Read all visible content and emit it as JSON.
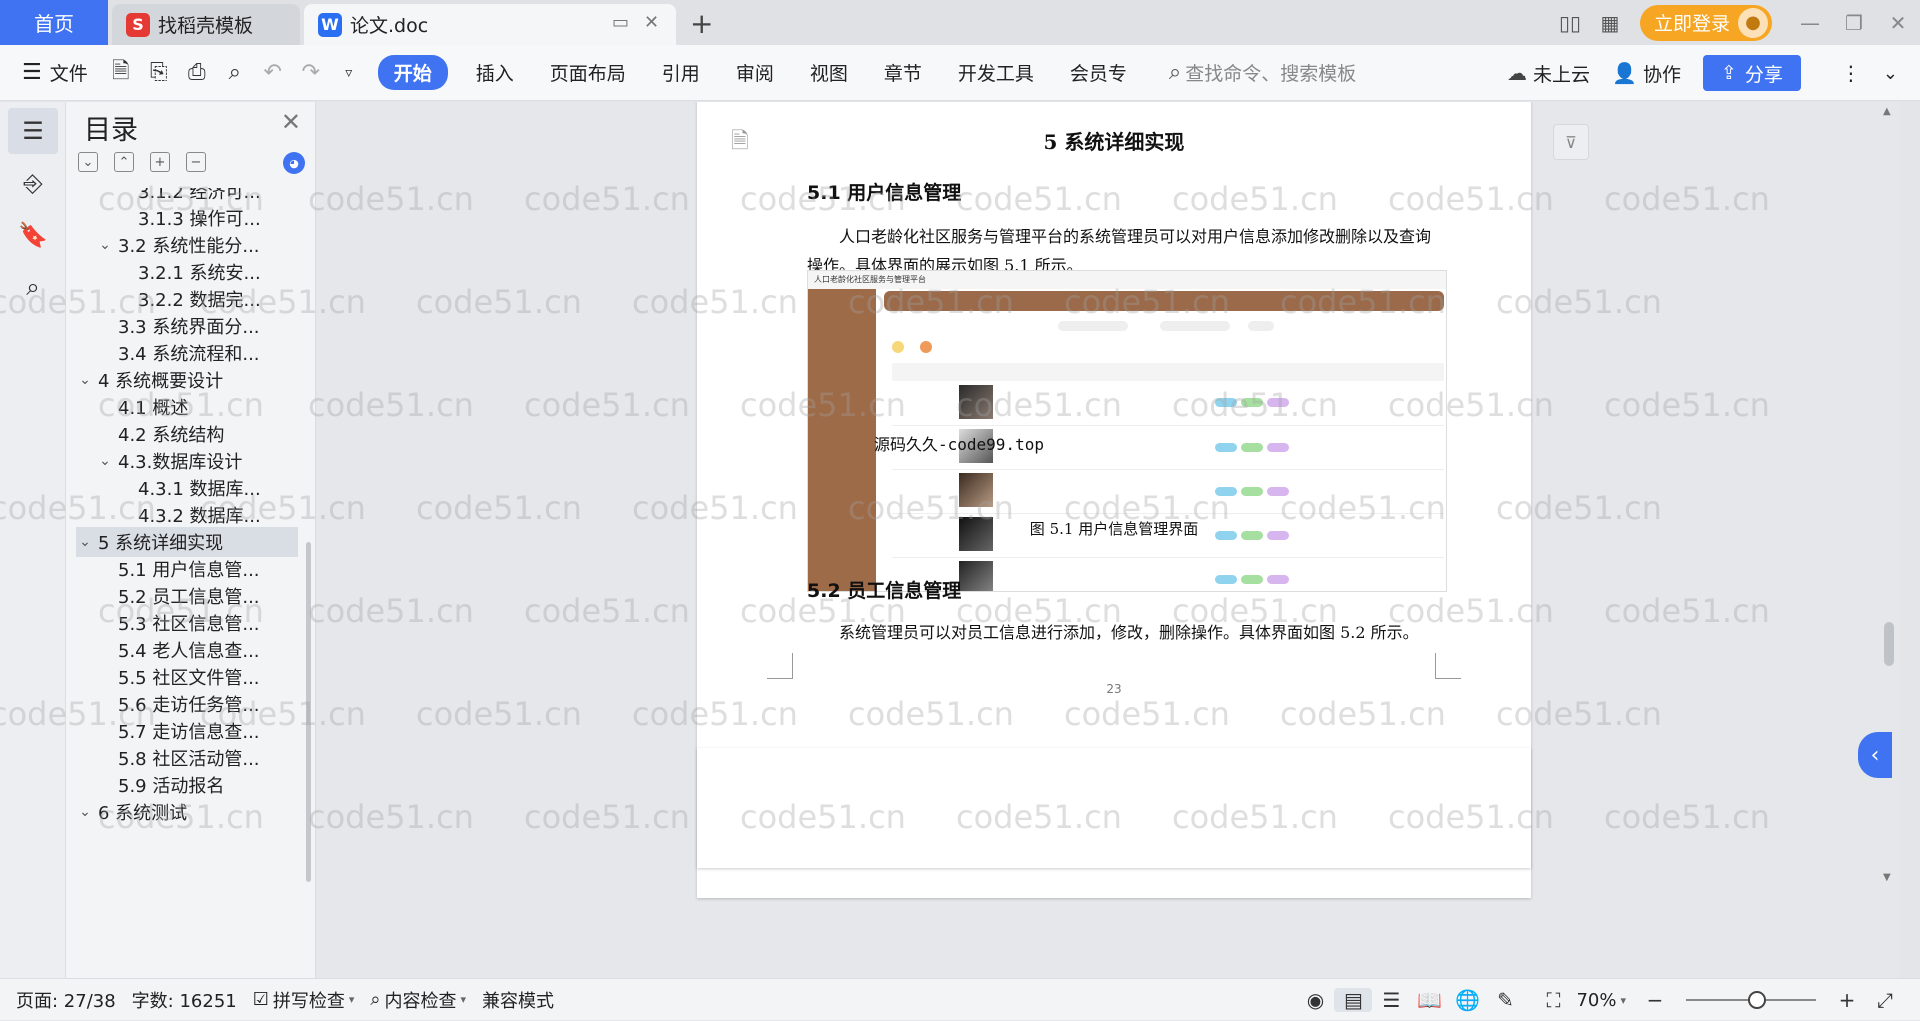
{
  "tabs": {
    "home": "首页",
    "template": "找稻壳模板",
    "doc": "论文.doc",
    "login": "立即登录"
  },
  "toolbar": {
    "file": "文件",
    "tabs": [
      "开始",
      "插入",
      "页面布局",
      "引用",
      "审阅",
      "视图",
      "章节",
      "开发工具",
      "会员专"
    ],
    "search_placeholder": "查找命令、搜索模板",
    "cloud": "未上云",
    "collab": "协作",
    "share": "分享"
  },
  "toc": {
    "title": "目录",
    "items": [
      {
        "label": "3.1.2 经济可...",
        "level": 3,
        "arrow": ""
      },
      {
        "label": "3.1.3 操作可...",
        "level": 3,
        "arrow": ""
      },
      {
        "label": "3.2 系统性能分...",
        "level": 2,
        "arrow": "⌄"
      },
      {
        "label": "3.2.1  系统安...",
        "level": 3,
        "arrow": ""
      },
      {
        "label": "3.2.2  数据完...",
        "level": 3,
        "arrow": ""
      },
      {
        "label": "3.3 系统界面分...",
        "level": 2,
        "arrow": ""
      },
      {
        "label": "3.4 系统流程和...",
        "level": 2,
        "arrow": ""
      },
      {
        "label": "4 系统概要设计",
        "level": 1,
        "arrow": "⌄"
      },
      {
        "label": "4.1 概述",
        "level": 2,
        "arrow": ""
      },
      {
        "label": "4.2 系统结构",
        "level": 2,
        "arrow": ""
      },
      {
        "label": "4.3.数据库设计",
        "level": 2,
        "arrow": "⌄"
      },
      {
        "label": "4.3.1 数据库...",
        "level": 3,
        "arrow": ""
      },
      {
        "label": "4.3.2 数据库...",
        "level": 3,
        "arrow": ""
      },
      {
        "label": "5 系统详细实现",
        "level": 1,
        "arrow": "⌄"
      },
      {
        "label": "5.1  用户信息管...",
        "level": 2,
        "arrow": ""
      },
      {
        "label": "5.2  员工信息管...",
        "level": 2,
        "arrow": ""
      },
      {
        "label": "5.3  社区信息管...",
        "level": 2,
        "arrow": ""
      },
      {
        "label": "5.4  老人信息查...",
        "level": 2,
        "arrow": ""
      },
      {
        "label": "5.5  社区文件管...",
        "level": 2,
        "arrow": ""
      },
      {
        "label": "5.6  走访任务管...",
        "level": 2,
        "arrow": ""
      },
      {
        "label": "5.7  走访信息查...",
        "level": 2,
        "arrow": ""
      },
      {
        "label": "5.8  社区活动管...",
        "level": 2,
        "arrow": ""
      },
      {
        "label": "5.9  活动报名",
        "level": 2,
        "arrow": ""
      },
      {
        "label": "6 系统测试",
        "level": 1,
        "arrow": "⌄"
      }
    ]
  },
  "doc": {
    "chapter": "5 系统详细实现",
    "sec1": "5.1  用户信息管理",
    "para1": "人口老龄化社区服务与管理平台的系统管理员可以对用户信息添加修改删除以及查询操作。具体界面的展示如图 5.1 所示。",
    "fig_caption": "图 5.1  用户信息管理界面",
    "sec2": "5.2  员工信息管理",
    "para2": "系统管理员可以对员工信息进行添加，修改，删除操作。具体界面如图 5.2 所示。",
    "page_number": "23",
    "overlay": "源码久久-code99.top",
    "shot_title": "人口老龄化社区服务与管理平台"
  },
  "watermark": "code51.cn",
  "status": {
    "page": "页面: 27/38",
    "words": "字数: 16251",
    "spell": "拼写检查",
    "content": "内容检查",
    "compat": "兼容模式",
    "zoom": "70%"
  }
}
